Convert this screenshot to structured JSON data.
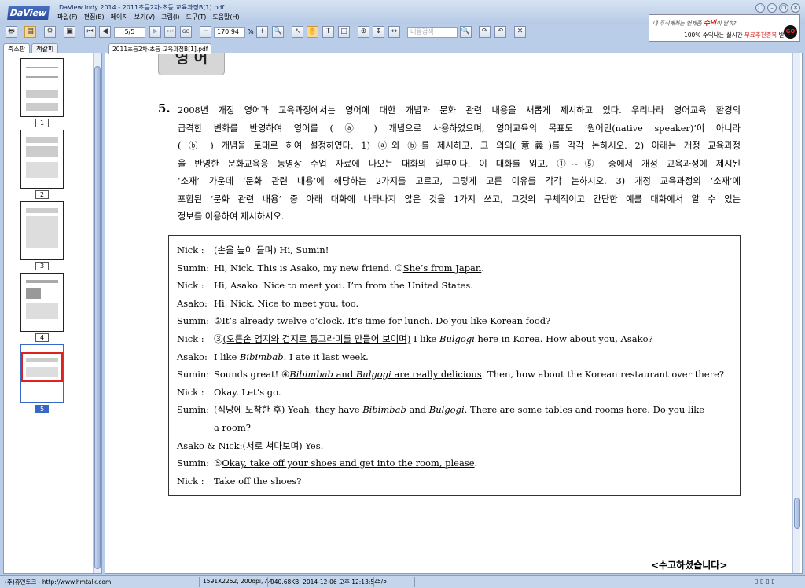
{
  "app": {
    "logo": "DaView",
    "title": "DaView Indy 2014 - 2011초등2차-초등 교육과정B[1].pdf",
    "menu": [
      "파일(F)",
      "편집(E)",
      "페이지",
      "보기(V)",
      "그림(I)",
      "도구(T)",
      "도움말(H)"
    ]
  },
  "ad": {
    "line1_a": "내 주식계좌는 언제쯤",
    "line1_b": "수익",
    "line1_c": "이 날까?",
    "line2_a": "100% 수익나는 실시간",
    "line2_b": "무료추천종목",
    "line2_c": "받기",
    "go": "GO"
  },
  "toolbar": {
    "page_value": "5/5",
    "zoom_value": "170.94",
    "zoom_unit": "%",
    "search_placeholder": "내용검색"
  },
  "sidebar": {
    "tabs": [
      "축소판",
      "책갈피"
    ],
    "thumbnails": [
      {
        "label": "1"
      },
      {
        "label": "2"
      },
      {
        "label": "3"
      },
      {
        "label": "4"
      },
      {
        "label": "5",
        "selected": true
      }
    ]
  },
  "document": {
    "tab": "2011초등2차-초등 교육과정B[1].pdf",
    "subject": "영 어",
    "question_number": "5.",
    "question_lines": [
      "2008년 개정 영어과 교육과정에서는 영어에 대한 개념과 문화 관련 내용을 새롭게 제시하고 있다. 우리나라 영어교육 환경의",
      "급격한 변화를 반영하여 영어를 (   ⓐ   ) 개념으로 사용하였으며, 영어교육의 목표도 ‘원어민(native speaker)’이 아니라",
      "(   ⓑ   ) 개념을 토대로 하여 설정하였다.  1) ⓐ와 ⓑ를 제시하고, 그 의의(意義)를 각각 논하시오.  2) 아래는 개정 교육과정",
      "을 반영한 문화교육용 동영상 수업 자료에 나오는 대화의 일부이다. 이 대화를 읽고, ①~⑤ 중에서 개정 교육과정에 제시된",
      "‘소재’ 가운데 ‘문화 관련 내용’에 해당하는 2가지를 고르고, 그렇게 고른 이유를 각각 논하시오.  3) 개정 교육과정의 ‘소재’에",
      "포함된 ‘문화 관련 내용’ 중 아래 대화에 나타나지 않은 것을 1가지 쓰고, 그것의 구체적이고 간단한 예를 대화에서 알 수 있는",
      "정보를 이용하여 제시하시오."
    ],
    "dialogue": [
      {
        "speaker": "Nick  :",
        "parts": [
          [
            "",
            "(손을 높이 들며) Hi, Sumin!"
          ]
        ]
      },
      {
        "speaker": "Sumin:",
        "parts": [
          [
            "",
            "Hi, Nick. This is Asako, my new friend. ①"
          ],
          [
            "u",
            "She’s from Japan"
          ],
          [
            "",
            "."
          ]
        ]
      },
      {
        "speaker": "Nick  :",
        "parts": [
          [
            "",
            "Hi, Asako. Nice to meet you. I’m from the United States."
          ]
        ]
      },
      {
        "speaker": "Asako:",
        "parts": [
          [
            "",
            "Hi, Nick. Nice to meet you, too."
          ]
        ]
      },
      {
        "speaker": "Sumin:",
        "parts": [
          [
            "",
            "②"
          ],
          [
            "u",
            "It’s already twelve o’clock"
          ],
          [
            "",
            ". It’s time for lunch. Do you like Korean food?"
          ]
        ]
      },
      {
        "speaker": "Nick  :",
        "parts": [
          [
            "",
            "③"
          ],
          [
            "u",
            "(오른손 엄지와 검지로 동그라미를 만들어 보이며)"
          ],
          [
            "",
            " I like "
          ],
          [
            "i",
            "Bulgogi"
          ],
          [
            "",
            " here in Korea. How about you, Asako?"
          ]
        ]
      },
      {
        "speaker": "Asako:",
        "parts": [
          [
            "",
            "I like "
          ],
          [
            "i",
            "Bibimbab"
          ],
          [
            "",
            ". I ate it last week."
          ]
        ]
      },
      {
        "speaker": "Sumin:",
        "parts": [
          [
            "",
            "Sounds great! ④"
          ],
          [
            "u i",
            "Bibimbab"
          ],
          [
            "u",
            " and "
          ],
          [
            "u i",
            "Bulgogi"
          ],
          [
            "u",
            " are really delicious"
          ],
          [
            "",
            ". Then, how about the Korean restaurant over there?"
          ]
        ]
      },
      {
        "speaker": "Nick  :",
        "parts": [
          [
            "",
            "Okay. Let’s go."
          ]
        ]
      },
      {
        "speaker": "Sumin:",
        "parts": [
          [
            "",
            "(식당에 도착한 후) Yeah, they have "
          ],
          [
            "i",
            "Bibimbab"
          ],
          [
            "",
            " and "
          ],
          [
            "i",
            "Bulgogi"
          ],
          [
            "",
            ". There are some tables and rooms here. Do you like"
          ]
        ]
      },
      {
        "speaker": "",
        "parts": [
          [
            "",
            "a room?"
          ]
        ],
        "cont": true
      },
      {
        "speaker": "Asako & Nick:",
        "parts": [
          [
            "",
            "(서로 쳐다보며) Yes."
          ]
        ]
      },
      {
        "speaker": "Sumin:",
        "parts": [
          [
            "",
            "⑤"
          ],
          [
            "u",
            "Okay, take off your shoes and get into the room, please"
          ],
          [
            "",
            "."
          ]
        ]
      },
      {
        "speaker": "Nick  :",
        "parts": [
          [
            "",
            "Take off the shoes?"
          ]
        ]
      }
    ],
    "closing": "<수고하셨습니다>"
  },
  "status": {
    "company": "(주)휴먼토크 - http://www.hmtalk.com",
    "info": "1591X2252, 200dpi, A4",
    "file": "940.68KB, 2014-12-06 오후 12:13:54",
    "page": "5/5"
  }
}
